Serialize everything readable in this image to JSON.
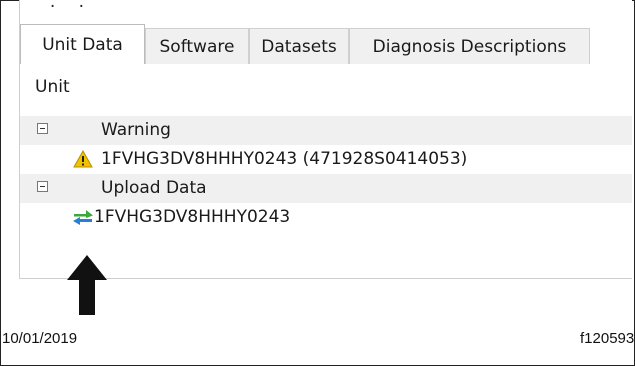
{
  "tabs": [
    {
      "label": "Unit Data",
      "active": true
    },
    {
      "label": "Software",
      "active": false
    },
    {
      "label": "Datasets",
      "active": false
    },
    {
      "label": "Diagnosis Descriptions",
      "active": false
    }
  ],
  "panel": {
    "column_header": "Unit",
    "groups": [
      {
        "label": "Warning",
        "expanded": true,
        "items": [
          {
            "icon": "warning-icon",
            "label": "1FVHG3DV8HHHY0243 (471928S0414053)"
          }
        ]
      },
      {
        "label": "Upload Data",
        "expanded": true,
        "items": [
          {
            "icon": "upload-transfer-icon",
            "label": "1FVHG3DV8HHHY0243"
          }
        ]
      }
    ]
  },
  "footer": {
    "date": "10/01/2019",
    "figure_id": "f120593"
  },
  "colors": {
    "tab_inactive": "#f0f0f0",
    "group_row": "#f0f0f0",
    "warning": "#f2c200",
    "upload_green": "#3aa93a",
    "upload_blue": "#2a7fd4"
  }
}
